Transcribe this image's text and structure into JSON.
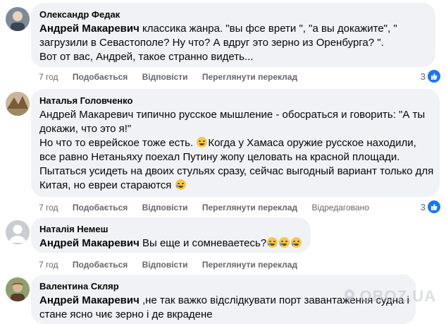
{
  "comments": [
    {
      "author": "Олександр Федак",
      "mention": "Андрей Макаревич",
      "lines": [
        " классика жанра. \"вы фсе врети \", \"а вы докажите\", \"",
        "загрузили в Севастополе? Ну что? А вдруг это зерно из Оренбурга? \".",
        "Вот от вас, Андрей, такое странно видеть..."
      ],
      "actions": {
        "time": "7 год",
        "like": "Подобається",
        "reply": "Відповісти",
        "translate": "Переглянути переклад"
      },
      "reaction_count": "3"
    },
    {
      "author": "Наталья Головченко",
      "mention": "",
      "lines": [
        "Андрей Макаревич типично русское мышление - обосраться и говорить: \"А ты",
        "докажи, что это я!\"",
        "Но что то еврейское тоже есть. ",
        "Когда у Хамаса оружие русское находили,",
        "все равно Нетаньяху поехал Путину жопу целовать на красной площади.",
        "Пытаться усидеть на двоих стульях сразу, сейчас выгодный вариант только для",
        "Китая, но евреи стараются "
      ],
      "actions": {
        "time": "7 год",
        "like": "Подобається",
        "reply": "Відповісти",
        "translate": "Переглянути переклад",
        "edited": "Відредаговано"
      },
      "reaction_count": "3"
    },
    {
      "author": "Наталія Немеш",
      "mention": "Андрей Макаревич",
      "lines": [
        " Вы еще и сомневаетесь?"
      ],
      "actions": {
        "time": "7 год",
        "like": "Подобається",
        "reply": "Відповісти",
        "translate": "Переглянути переклад"
      }
    },
    {
      "author": "Валентина Скляр",
      "mention": "Андрей Макаревич",
      "lines": [
        " ,не так важко відслідкувати порт завантаження судна і",
        "стане ясно чиє зерно і де вкрадене"
      ]
    }
  ],
  "watermark": "OBOZ.UA",
  "colors": {
    "bubble": "#f0f2f5",
    "like": "#1877f2",
    "meta": "#65676b"
  }
}
